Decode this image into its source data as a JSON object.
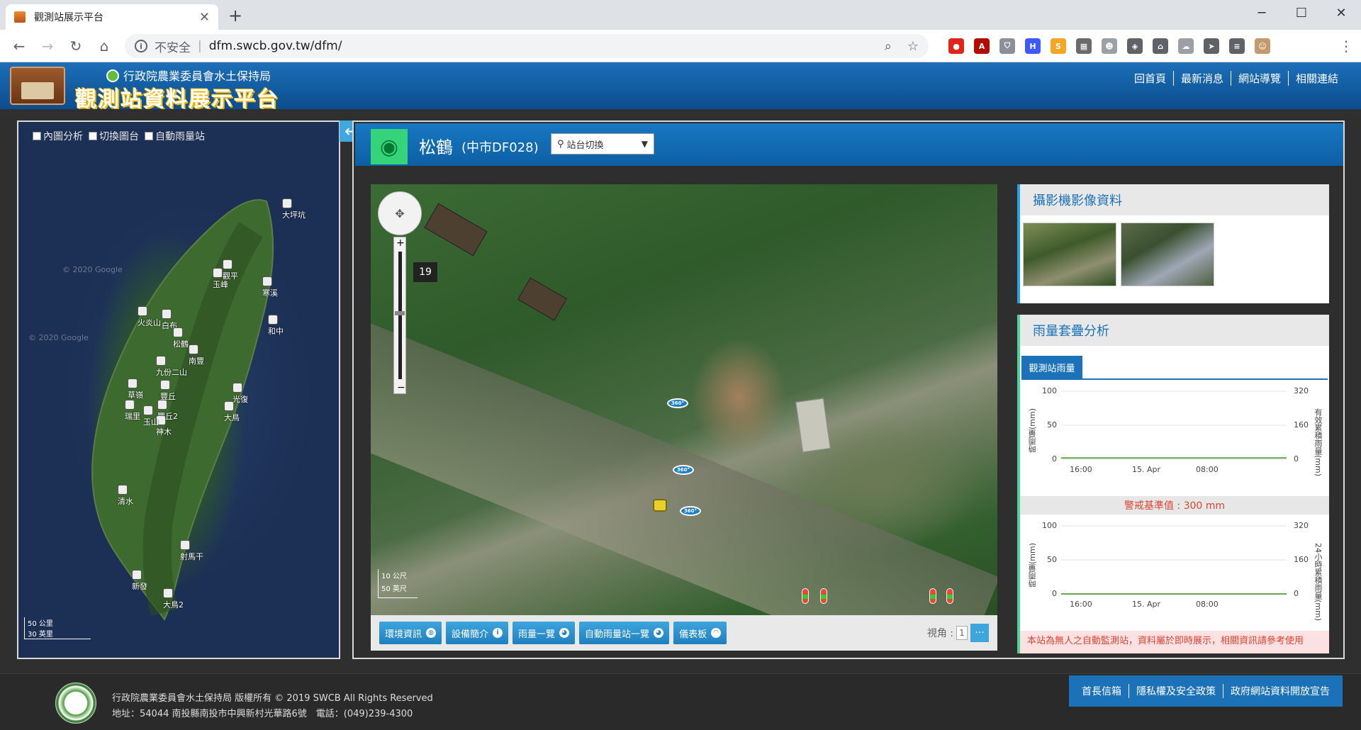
{
  "browser": {
    "tab_title": "觀測站展示平台",
    "tab_close": "✕",
    "new_tab": "+",
    "win_min": "─",
    "win_max": "☐",
    "win_close": "✕",
    "security_label": "不安全",
    "url": "dfm.swcb.gov.tw/dfm/",
    "extensions": [
      {
        "name": "adblock-icon",
        "color": "#e2231a",
        "glyph": "●"
      },
      {
        "name": "pdf-icon",
        "color": "#b30b00",
        "glyph": "A"
      },
      {
        "name": "pocket-icon",
        "color": "#8a8f98",
        "glyph": "⛉"
      },
      {
        "name": "h-icon",
        "color": "#3d5afe",
        "glyph": "H"
      },
      {
        "name": "smart-icon",
        "color": "#f5a623",
        "glyph": "S"
      },
      {
        "name": "puzzle-icon",
        "color": "#6b6b6b",
        "glyph": "▦"
      },
      {
        "name": "ghost-icon",
        "color": "#9aa0a6",
        "glyph": "☻"
      },
      {
        "name": "shield-icon",
        "color": "#5f6368",
        "glyph": "◈"
      },
      {
        "name": "home-ext-icon",
        "color": "#5f6368",
        "glyph": "⌂"
      },
      {
        "name": "cloud-icon",
        "color": "#9aa0a6",
        "glyph": "☁"
      },
      {
        "name": "send-icon",
        "color": "#5f6368",
        "glyph": "➤"
      },
      {
        "name": "playlist-icon",
        "color": "#5f6368",
        "glyph": "≡"
      },
      {
        "name": "profile-avatar-icon",
        "color": "#c49a6c",
        "glyph": "☺"
      }
    ]
  },
  "site": {
    "agency": "行政院農業委員會水土保持局",
    "title": "觀測站資料展示平台",
    "nav": [
      "回首頁",
      "最新消息",
      "網站導覽",
      "相關連結"
    ]
  },
  "left_map": {
    "checks": [
      "內圖分析",
      "切換圖台",
      "自動雨量站"
    ],
    "watermark": "© 2020 Google",
    "scale": "50 公里",
    "scale2": "30 英里",
    "stations": [
      {
        "label": "大坪坑"
      },
      {
        "label": "觀平"
      },
      {
        "label": "玉峰"
      },
      {
        "label": "寒溪"
      },
      {
        "label": "火炎山"
      },
      {
        "label": "白布"
      },
      {
        "label": "和中"
      },
      {
        "label": "松鶴"
      },
      {
        "label": "南豐"
      },
      {
        "label": "九份二山"
      },
      {
        "label": "豐丘"
      },
      {
        "label": "草嶺"
      },
      {
        "label": "豐丘2"
      },
      {
        "label": "瑞里"
      },
      {
        "label": "神木"
      },
      {
        "label": "玉山"
      },
      {
        "label": "光復"
      },
      {
        "label": "清水"
      },
      {
        "label": "大鳥"
      },
      {
        "label": "新發"
      },
      {
        "label": "射馬干"
      },
      {
        "label": "大鳥2"
      }
    ]
  },
  "panel": {
    "station_name": "松鶴",
    "station_code": "(中市DF028)",
    "switcher_label": "站台切換",
    "zoom_level": "19",
    "pano_label": "360°",
    "scale_top": "10 公尺",
    "scale_bottom": "50 英尺",
    "buttons": [
      {
        "label": "環境資訊",
        "icon": "globe-icon"
      },
      {
        "label": "設備簡介",
        "icon": "info-icon"
      },
      {
        "label": "雨量一覽",
        "icon": "rain-icon"
      },
      {
        "label": "自動雨量站一覽",
        "icon": "list-icon"
      },
      {
        "label": "儀表板",
        "icon": "dashboard-icon"
      }
    ],
    "view_angle_label": "視角 :",
    "view_angle_value": "1",
    "view_more": "···"
  },
  "camera_card": {
    "title": "攝影機影像資料"
  },
  "rain_card": {
    "title": "雨量套疊分析",
    "tab": "觀測站雨量",
    "warning": "警戒基準值 : 300 mm",
    "notice": "本站為無人之自動監測站，資料屬於即時展示，相關資訊請參考使用",
    "chart1": {
      "yl": "時雨量(mm)",
      "yr": "有效累積雨量(mm)"
    },
    "chart2": {
      "yl": "時雨量(mm)",
      "yr": "24小時累積雨量(mm)"
    }
  },
  "chart_data": [
    {
      "type": "line",
      "title": "",
      "xlabel": "",
      "ylabel": "時雨量(mm)",
      "y2label": "有效累積雨量(mm)",
      "x_ticks": [
        "16:00",
        "15. Apr",
        "08:00"
      ],
      "y_ticks": [
        "100",
        "50",
        "0"
      ],
      "y2_ticks": [
        "320",
        "160",
        "0"
      ],
      "ylim": [
        0,
        100
      ],
      "y2lim": [
        0,
        320
      ],
      "series": [
        {
          "values": [
            2,
            2,
            2,
            2,
            2
          ]
        }
      ]
    },
    {
      "type": "line",
      "title": "",
      "xlabel": "",
      "ylabel": "時雨量(mm)",
      "y2label": "24小時累積雨量(mm)",
      "x_ticks": [
        "16:00",
        "15. Apr",
        "08:00"
      ],
      "y_ticks": [
        "100",
        "50",
        "0"
      ],
      "y2_ticks": [
        "320",
        "160",
        "0"
      ],
      "ylim": [
        0,
        100
      ],
      "y2lim": [
        0,
        320
      ],
      "series": [
        {
          "values": [
            0,
            0,
            0,
            0,
            0
          ]
        }
      ]
    }
  ],
  "footer": {
    "copyright": "行政院農業委員會水土保持局 版權所有 © 2019 SWCB All Rights Reserved",
    "address": "地址：54044 南投縣南投市中興新村光華路6號　電話：(049)239-4300",
    "links": [
      "首長信箱",
      "隱私權及安全政策",
      "政府網站資料開放宣告"
    ]
  }
}
